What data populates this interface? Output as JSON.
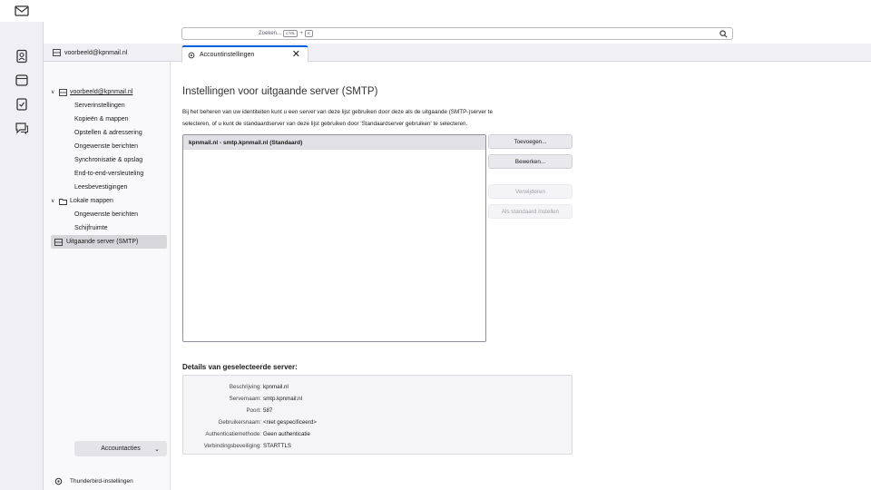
{
  "search": {
    "placeholder": "Zoeken...",
    "shortcut_key1": "CTRL",
    "shortcut_plus": "+",
    "shortcut_key2": "K"
  },
  "account_header": {
    "label": "voorbeeld@kpnmail.nl"
  },
  "tab": {
    "title": "Accountinstellingen",
    "close": "✕"
  },
  "sidebar": {
    "account": "voorbeeld@kpnmail.nl",
    "account_items": [
      "Serverinstellingen",
      "Kopieën & mappen",
      "Opstellen & adressering",
      "Ongewenste berichten",
      "Synchronisatie & opslag",
      "End-to-end-versleuteling",
      "Leesbevestigingen"
    ],
    "local_folders": "Lokale mappen",
    "local_items": [
      "Ongewenste berichten",
      "Schijfruimte"
    ],
    "smtp": "Uitgaande server (SMTP)",
    "account_actions": "Accountacties",
    "account_actions_chevron": "⌄",
    "thunderbird_settings": "Thunderbird-instellingen"
  },
  "main": {
    "title": "Instellingen voor uitgaande server (SMTP)",
    "description_line1": "Bij het beheren van uw identiteiten kunt u een server van deze lijst gebruiken door deze als de uitgaande (SMTP-)server te",
    "description_line2": "selecteren, of u kunt de standaardserver van deze lijst gebruiken door 'Standaardserver gebruiken' te selecteren.",
    "server_list": [
      "kpnmail.nl - smtp.kpnmail.nl (Standaard)"
    ],
    "buttons": {
      "add": "Toevoegen...",
      "edit": "Bewerken...",
      "remove": "Verwijderen",
      "set_default": "Als standaard instellen"
    },
    "details_title": "Details van geselecteerde server:",
    "details": [
      {
        "label": "Beschrijving:",
        "value": "kpnmail.nl"
      },
      {
        "label": "Servernaam:",
        "value": "smtp.kpnmail.nl"
      },
      {
        "label": "Poort:",
        "value": "587"
      },
      {
        "label": "Gebruikersnaam:",
        "value": "<niet gespecificeerd>"
      },
      {
        "label": "Authenticatiemethode:",
        "value": "Geen authenticatie"
      },
      {
        "label": "Verbindingsbeveiliging:",
        "value": "STARTTLS"
      }
    ]
  },
  "colors": {
    "accent": "#0061e0",
    "selection": "#e0e0e6",
    "sidebar_selection": "#d7d7db"
  }
}
